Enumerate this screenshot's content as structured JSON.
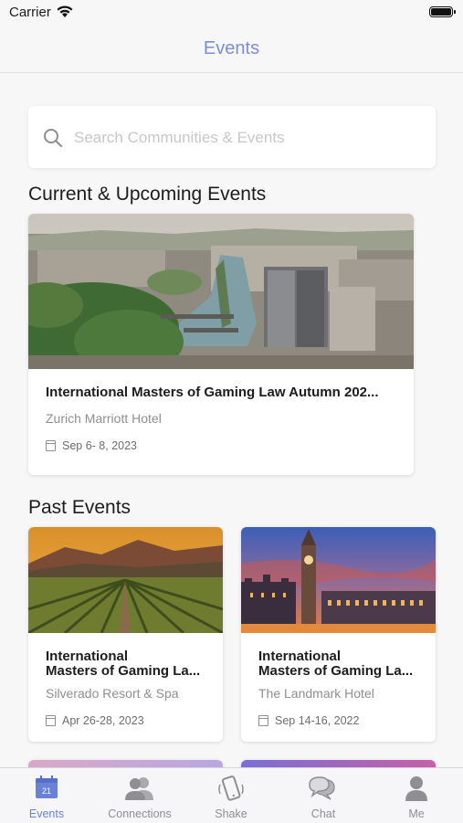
{
  "status_bar": {
    "carrier": "Carrier"
  },
  "nav": {
    "title": "Events"
  },
  "search": {
    "placeholder": "Search Communities & Events"
  },
  "sections": {
    "current": "Current & Upcoming Events",
    "past": "Past Events"
  },
  "current_events": [
    {
      "title": "International Masters of Gaming Law Autumn 202...",
      "venue": "Zurich Marriott Hotel",
      "date": "Sep  6- 8, 2023"
    }
  ],
  "past_events": [
    {
      "title_line1": "International",
      "title_line2": "Masters of Gaming La...",
      "venue": "Silverado Resort & Spa",
      "date": "Apr 26-28, 2023"
    },
    {
      "title_line1": "International",
      "title_line2": "Masters of Gaming La...",
      "venue": "The Landmark Hotel",
      "date": "Sep 14-16, 2022"
    }
  ],
  "tab_bar": {
    "items": [
      {
        "label": "Events",
        "icon": "calendar-icon",
        "badge": "21",
        "active": true
      },
      {
        "label": "Connections",
        "icon": "people-icon"
      },
      {
        "label": "Shake",
        "icon": "phone-shake-icon"
      },
      {
        "label": "Chat",
        "icon": "chat-bubbles-icon"
      },
      {
        "label": "Me",
        "icon": "person-icon"
      }
    ]
  },
  "colors": {
    "accent": "#6a82d6",
    "nav_title": "#7b8ed6",
    "background": "#f7f7f8"
  }
}
